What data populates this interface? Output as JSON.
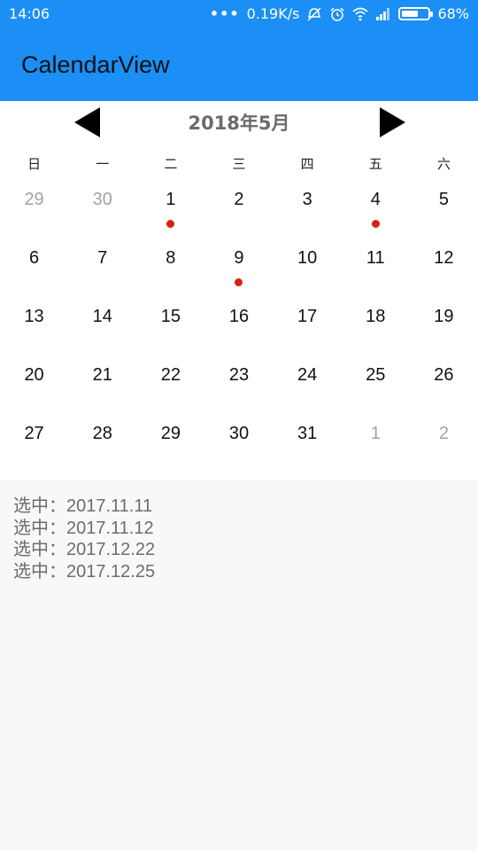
{
  "status_bar": {
    "time": "14:06",
    "dots": "•••",
    "net_speed": "0.19K/s",
    "battery_text": "68%",
    "battery_level": 0.68,
    "icons": [
      "mute-icon",
      "alarm-icon",
      "wifi-icon",
      "signal-icon",
      "battery-icon"
    ]
  },
  "app_bar": {
    "title": "CalendarView",
    "color": "#1b8ff5"
  },
  "calendar": {
    "month_title": "2018年5月",
    "weekdays": [
      "日",
      "一",
      "二",
      "三",
      "四",
      "五",
      "六"
    ],
    "days": [
      {
        "d": "29",
        "other": true,
        "dot": false
      },
      {
        "d": "30",
        "other": true,
        "dot": false
      },
      {
        "d": "1",
        "other": false,
        "dot": true
      },
      {
        "d": "2",
        "other": false,
        "dot": false
      },
      {
        "d": "3",
        "other": false,
        "dot": false
      },
      {
        "d": "4",
        "other": false,
        "dot": true
      },
      {
        "d": "5",
        "other": false,
        "dot": false
      },
      {
        "d": "6",
        "other": false,
        "dot": false
      },
      {
        "d": "7",
        "other": false,
        "dot": false
      },
      {
        "d": "8",
        "other": false,
        "dot": false
      },
      {
        "d": "9",
        "other": false,
        "dot": true
      },
      {
        "d": "10",
        "other": false,
        "dot": false
      },
      {
        "d": "11",
        "other": false,
        "dot": false
      },
      {
        "d": "12",
        "other": false,
        "dot": false
      },
      {
        "d": "13",
        "other": false,
        "dot": false
      },
      {
        "d": "14",
        "other": false,
        "dot": false
      },
      {
        "d": "15",
        "other": false,
        "dot": false
      },
      {
        "d": "16",
        "other": false,
        "dot": false
      },
      {
        "d": "17",
        "other": false,
        "dot": false
      },
      {
        "d": "18",
        "other": false,
        "dot": false
      },
      {
        "d": "19",
        "other": false,
        "dot": false
      },
      {
        "d": "20",
        "other": false,
        "dot": false
      },
      {
        "d": "21",
        "other": false,
        "dot": false
      },
      {
        "d": "22",
        "other": false,
        "dot": false
      },
      {
        "d": "23",
        "other": false,
        "dot": false
      },
      {
        "d": "24",
        "other": false,
        "dot": false
      },
      {
        "d": "25",
        "other": false,
        "dot": false
      },
      {
        "d": "26",
        "other": false,
        "dot": false
      },
      {
        "d": "27",
        "other": false,
        "dot": false
      },
      {
        "d": "28",
        "other": false,
        "dot": false
      },
      {
        "d": "29",
        "other": false,
        "dot": false
      },
      {
        "d": "30",
        "other": false,
        "dot": false
      },
      {
        "d": "31",
        "other": false,
        "dot": false
      },
      {
        "d": "1",
        "other": true,
        "dot": false
      },
      {
        "d": "2",
        "other": true,
        "dot": false
      }
    ],
    "dot_color": "#d8230f"
  },
  "selections": [
    "选中：2017.11.11",
    "选中：2017.11.12",
    "选中：2017.12.22",
    "选中：2017.12.25"
  ]
}
